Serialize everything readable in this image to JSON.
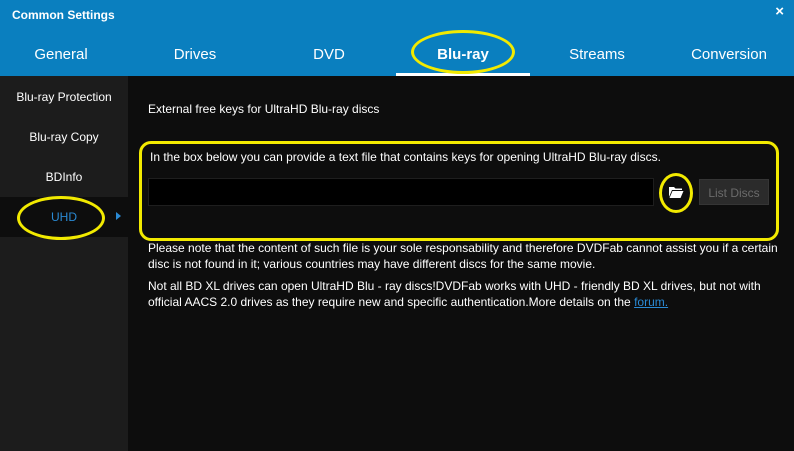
{
  "window": {
    "title": "Common Settings",
    "close_glyph": "×"
  },
  "tabs": [
    {
      "label": "General"
    },
    {
      "label": "Drives"
    },
    {
      "label": "DVD"
    },
    {
      "label": "Blu-ray"
    },
    {
      "label": "Streams"
    },
    {
      "label": "Conversion"
    }
  ],
  "active_tab": "Blu-ray",
  "sidebar": {
    "items": [
      {
        "label": "Blu-ray Protection"
      },
      {
        "label": "Blu-ray Copy"
      },
      {
        "label": "BDInfo"
      },
      {
        "label": "UHD"
      }
    ],
    "active": "UHD"
  },
  "content": {
    "heading": "External free keys for UltraHD Blu-ray discs",
    "instruction": "In the box below you can provide a text file that contains keys for opening UltraHD Blu-ray discs.",
    "keyfile_value": "",
    "list_discs_label": "List Discs",
    "note1": "Please note that the content of such file is your sole responsability and therefore DVDFab cannot assist you if a certain disc is not found in it; various countries may have different discs for the same movie.",
    "note2_text": "Not all BD XL drives can open UltraHD Blu - ray discs!DVDFab works with UHD - friendly BD XL drives, but not with official AACS 2.0 drives as they require new and specific authentication.More details on the ",
    "forum_link": "forum."
  },
  "colors": {
    "header": "#0a7fbf",
    "sidebar": "#1c1c1c",
    "content": "#0d0d0d",
    "accent": "#2a8ad4",
    "annotation": "#f2ea00"
  },
  "icons": {
    "browse": "folder-open-icon",
    "active_marker": "triangle-right-icon"
  }
}
